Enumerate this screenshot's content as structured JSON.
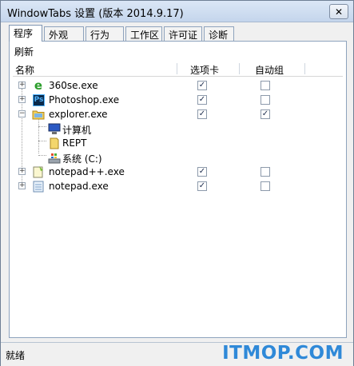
{
  "window": {
    "title": "WindowTabs 设置 (版本 2014.9.17)",
    "close_glyph": "✕"
  },
  "tabs": [
    {
      "label": "程序",
      "active": true
    },
    {
      "label": "外观"
    },
    {
      "label": "行为"
    },
    {
      "label": "工作区"
    },
    {
      "label": "许可证"
    },
    {
      "label": "诊断"
    }
  ],
  "panel": {
    "refresh_label": "刷新",
    "columns": {
      "name": "名称",
      "tab": "选项卡",
      "autogroup": "自动组"
    },
    "rows": [
      {
        "label": "360se.exe",
        "icon": "ie-icon",
        "expander": "+",
        "tab_checked": true,
        "autogroup_checked": false
      },
      {
        "label": "Photoshop.exe",
        "icon": "photoshop-icon",
        "icon_text": "Ps",
        "expander": "+",
        "tab_checked": true,
        "autogroup_checked": false
      },
      {
        "label": "explorer.exe",
        "icon": "folder-icon",
        "expander": "−",
        "tab_checked": true,
        "autogroup_checked": true
      },
      {
        "label": "计算机",
        "icon": "computer-icon",
        "child": true
      },
      {
        "label": "REPT",
        "icon": "folder-icon",
        "child": true
      },
      {
        "label": "系统 (C:)",
        "icon": "drive-icon",
        "child": true
      },
      {
        "label": "notepad++.exe",
        "icon": "notepadpp-icon",
        "expander": "+",
        "tab_checked": true,
        "autogroup_checked": false
      },
      {
        "label": "notepad.exe",
        "icon": "notepad-icon",
        "expander": "+",
        "tab_checked": true,
        "autogroup_checked": false
      }
    ]
  },
  "status": {
    "text": "就绪"
  },
  "watermark": {
    "text": "ITMOP.COM"
  },
  "colors": {
    "titlebar": "#c4d5ec",
    "panel_border": "#8ea3bd",
    "watermark": "#2f89d8"
  }
}
